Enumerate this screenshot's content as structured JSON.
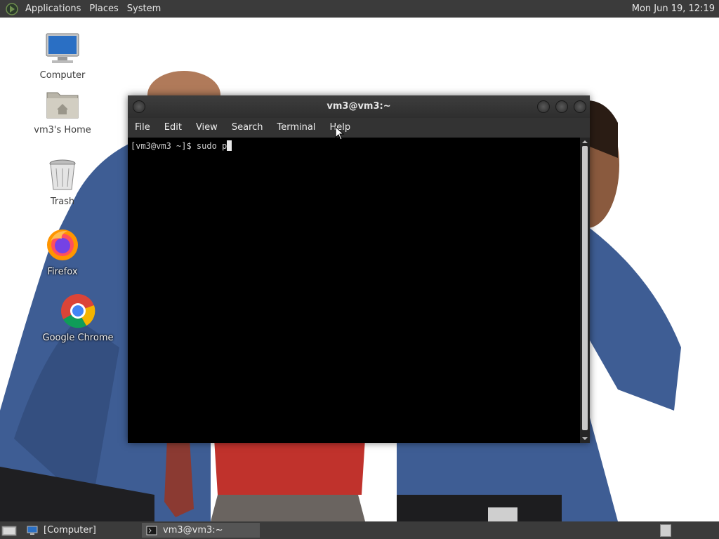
{
  "top_panel": {
    "menus": [
      "Applications",
      "Places",
      "System"
    ],
    "clock": "Mon Jun 19, 12:19"
  },
  "desktop": {
    "icons": [
      {
        "label": "Computer",
        "icon": "computer-icon"
      },
      {
        "label": "vm3's Home",
        "icon": "home-folder-icon"
      },
      {
        "label": "Trash",
        "icon": "trash-icon"
      },
      {
        "label": "Firefox",
        "icon": "firefox-icon"
      },
      {
        "label": "Google Chrome",
        "icon": "chrome-icon"
      }
    ]
  },
  "terminal": {
    "title": "vm3@vm3:~",
    "menu": [
      "File",
      "Edit",
      "View",
      "Search",
      "Terminal",
      "Help"
    ],
    "prompt": "[vm3@vm3 ~]$ ",
    "input": "sudo p"
  },
  "bottom_panel": {
    "tasks": [
      {
        "label": "[Computer]",
        "icon": "computer-icon",
        "active": false
      },
      {
        "label": "vm3@vm3:~",
        "icon": "terminal-icon",
        "active": true
      }
    ]
  },
  "colors": {
    "panel_bg": "#3b3b3b",
    "terminal_bg": "#000000",
    "shirt_blue": "#3e5d94",
    "shirt_red": "#c0322c"
  }
}
